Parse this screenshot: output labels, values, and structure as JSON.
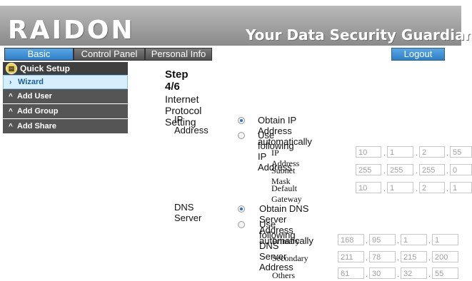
{
  "brand": {
    "logo": "RAIDON",
    "tagline": "Your Data Security Guardian."
  },
  "tabs": [
    {
      "label": "Basic",
      "active": true
    },
    {
      "label": "Control Panel",
      "active": false
    },
    {
      "label": "Personal Info",
      "active": false
    }
  ],
  "logout_label": "Logout",
  "sidebar": {
    "header": "Quick Setup",
    "items": [
      {
        "label": "Wizard",
        "chev": "›",
        "selected": true
      },
      {
        "label": "Add User",
        "chev": "^"
      },
      {
        "label": "Add Group",
        "chev": "^"
      },
      {
        "label": "Add Share",
        "chev": "^"
      }
    ]
  },
  "main": {
    "step": "Step 4/6",
    "section_title": "Internet Protocol Setting",
    "ip": {
      "label": "IP Address",
      "opt_auto": "Obtain IP Address automatically",
      "opt_manual": "Use following IP Address",
      "selected": "auto",
      "fields": [
        {
          "label": "IP Address",
          "octets": [
            "10",
            "1",
            "2",
            "55"
          ]
        },
        {
          "label": "Subnet Mask",
          "octets": [
            "255",
            "255",
            "255",
            "0"
          ]
        },
        {
          "label": "Default Gateway",
          "octets": [
            "10",
            "1",
            "2",
            "1"
          ]
        }
      ]
    },
    "dns": {
      "label": "DNS Server",
      "opt_auto": "Obtain DNS Server Address automatically",
      "opt_manual": "Use following DNS Server Address",
      "selected": "auto",
      "fields": [
        {
          "label": "Primary",
          "octets": [
            "168",
            "95",
            "1",
            "1"
          ]
        },
        {
          "label": "Secondary",
          "octets": [
            "211",
            "78",
            "215",
            "200"
          ]
        },
        {
          "label": "Others",
          "octets": [
            "61",
            "30",
            "32",
            "55"
          ]
        }
      ]
    }
  },
  "colors": {
    "accent": "#2d7fc8",
    "banner": "#9e9e9e",
    "sidebar_dark": "#3f3f3f",
    "sidebar_item": "#555555",
    "wizard_bg": "#d6efff"
  }
}
